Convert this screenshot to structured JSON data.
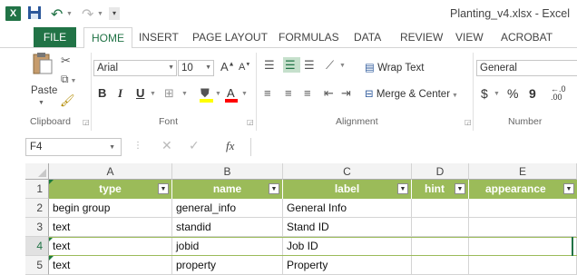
{
  "app": {
    "window_title": "Planting_v4.xlsx - Excel",
    "logo_letter": "X",
    "brand_color": "#217346"
  },
  "qat": {
    "save_icon": "save-icon",
    "undo_icon": "undo-icon",
    "redo_icon": "redo-icon"
  },
  "tabs": [
    "FILE",
    "HOME",
    "INSERT",
    "PAGE LAYOUT",
    "FORMULAS",
    "DATA",
    "REVIEW",
    "VIEW",
    "ACROBAT"
  ],
  "ribbon": {
    "clipboard": {
      "paste_label": "Paste",
      "group_label": "Clipboard"
    },
    "font": {
      "font_name": "Arial",
      "font_size": "10",
      "bold": "B",
      "italic": "I",
      "underline": "U",
      "grow": "A",
      "shrink": "A",
      "font_color_letter": "A",
      "group_label": "Font",
      "fill_color": "#ffff00",
      "font_color": "#ff0000"
    },
    "alignment": {
      "wrap_text": "Wrap Text",
      "merge_center": "Merge & Center",
      "group_label": "Alignment"
    },
    "number": {
      "format": "General",
      "currency": "$",
      "percent": "%",
      "comma": "9",
      "inc_decimal_top": "←.0",
      "inc_decimal_bottom": ".00",
      "group_label": "Number"
    }
  },
  "formula_bar": {
    "name_box": "F4",
    "fx": "fx",
    "formula": ""
  },
  "sheet": {
    "columns": [
      "A",
      "B",
      "C",
      "D",
      "E"
    ],
    "header_fill": "#9bbb59",
    "header_row": [
      "type",
      "name",
      "label",
      "hint",
      "appearance"
    ],
    "rows": [
      {
        "num": "1"
      },
      {
        "num": "2",
        "cells": [
          "begin group",
          "general_info",
          "General Info",
          "",
          ""
        ]
      },
      {
        "num": "3",
        "cells": [
          "text",
          "standid",
          "Stand ID",
          "",
          ""
        ]
      },
      {
        "num": "4",
        "cells": [
          "text",
          "jobid",
          "Job ID",
          "",
          ""
        ]
      },
      {
        "num": "5",
        "cells": [
          "text",
          "property",
          "Property",
          "",
          ""
        ]
      }
    ]
  }
}
